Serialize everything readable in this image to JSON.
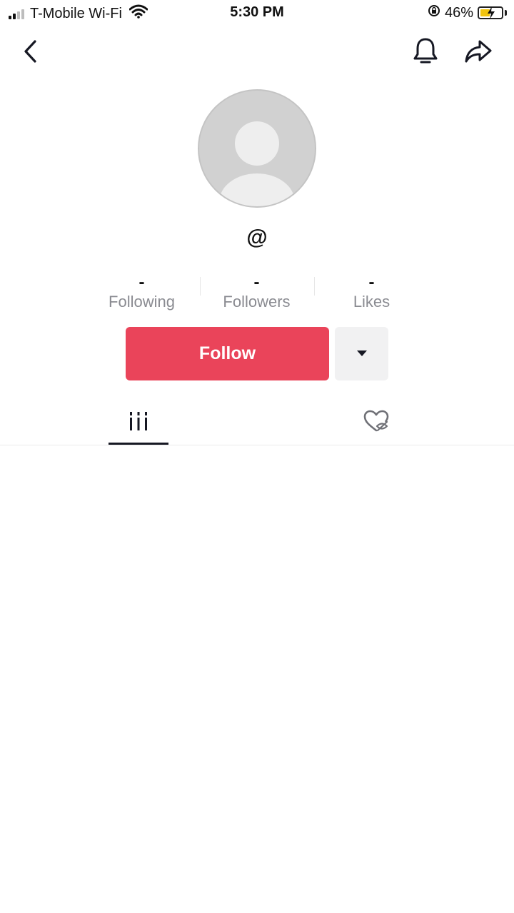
{
  "status_bar": {
    "carrier": "T-Mobile Wi-Fi",
    "time": "5:30 PM",
    "battery_percent": "46%",
    "battery_level": 0.46,
    "signal_bars_active": 2,
    "signal_bars_total": 4
  },
  "nav": {
    "back_icon": "chevron-left-icon",
    "bell_icon": "bell-icon",
    "share_icon": "share-arrow-icon"
  },
  "profile": {
    "avatar_icon": "default-avatar",
    "username": "@"
  },
  "stats": [
    {
      "count": "-",
      "label": "Following"
    },
    {
      "count": "-",
      "label": "Followers"
    },
    {
      "count": "-",
      "label": "Likes"
    }
  ],
  "actions": {
    "follow_label": "Follow",
    "more_icon": "caret-down-icon"
  },
  "tabs": {
    "videos_icon": "videos-grid-icon",
    "liked_icon": "liked-hidden-heart-icon"
  },
  "colors": {
    "follow_button": "#ea445a",
    "more_button": "#f1f1f2",
    "secondary_text": "#8a8b91",
    "battery_fill": "#f1c40f"
  }
}
